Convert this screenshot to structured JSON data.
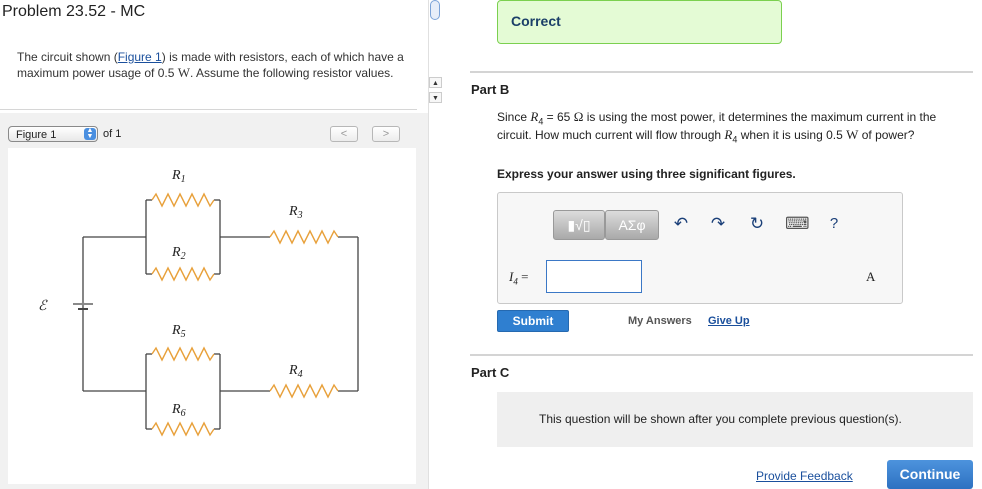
{
  "problem": {
    "title": "Problem 23.52 - MC",
    "intro_before_link": "The circuit shown (",
    "figure_link": "Figure 1",
    "intro_after_link": ") is made with resistors, each of which have a maximum power usage of 0.5 ",
    "power_unit": "W",
    "intro_end": ". Assume the following resistor values."
  },
  "figure_nav": {
    "selected": "Figure 1",
    "of_label": "of 1",
    "prev": "<",
    "next": ">"
  },
  "circuit": {
    "emf_label": "ℰ",
    "labels": {
      "r1": "R",
      "r1_sub": "1",
      "r2": "R",
      "r2_sub": "2",
      "r3": "R",
      "r3_sub": "3",
      "r4": "R",
      "r4_sub": "4",
      "r5": "R",
      "r5_sub": "5",
      "r6": "R",
      "r6_sub": "6"
    },
    "resistor_color": "#e8a13c"
  },
  "status": {
    "correct_label": "Correct"
  },
  "part_b": {
    "title": "Part B",
    "q1": "Since ",
    "var": "R",
    "var_sub": "4",
    "q2": " = 65 ",
    "ohm": "Ω",
    "q3": " is using the most power, it determines the maximum current in the circuit.  How much current will flow through ",
    "q4": " when it is using 0.5 ",
    "watt": "W",
    "q5": " of power?",
    "instruction": "Express your answer using three significant figures.",
    "toolbar": {
      "template_label": "▮√▯",
      "symbols_label": "ΑΣφ",
      "undo_icon": "↶",
      "redo_icon": "↷",
      "reset_icon": "↻",
      "keyboard_icon": "⌨",
      "help_label": "?"
    },
    "answer_var": "I",
    "answer_var_sub": "4",
    "answer_eq": " =",
    "answer_value": "",
    "unit": "A",
    "submit_label": "Submit",
    "my_answers_label": "My Answers",
    "give_up_label": "Give Up"
  },
  "part_c": {
    "title": "Part C",
    "message": "This question will be shown after you complete previous question(s)."
  },
  "footer": {
    "feedback_label": "Provide Feedback",
    "continue_label": "Continue"
  },
  "colors": {
    "accent": "#2f7fd0",
    "correct_bg": "#e4fbd5",
    "correct_border": "#7bd04f",
    "link": "#1a4f9c"
  }
}
